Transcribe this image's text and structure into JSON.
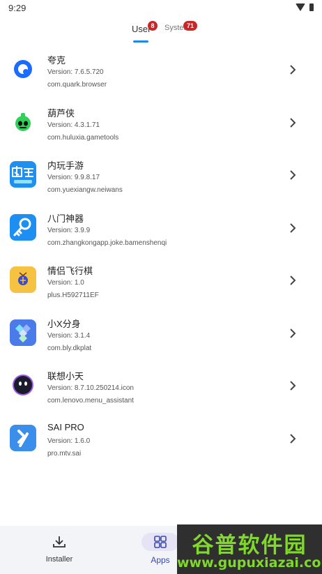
{
  "status": {
    "time": "9:29"
  },
  "tabs": [
    {
      "label": "User",
      "badge": "8"
    },
    {
      "label": "System",
      "badge": "71"
    }
  ],
  "apps": [
    {
      "name": "夸克",
      "version": "Version: 7.6.5.720",
      "package": "com.quark.browser",
      "icon": "quark-icon",
      "color": "#1a6cff"
    },
    {
      "name": "葫芦侠",
      "version": "Version: 4.3.1.71",
      "package": "com.huluxia.gametools",
      "icon": "huluxia-icon",
      "color": "#2fd158"
    },
    {
      "name": "内玩手游",
      "version": "Version: 9.9.8.17",
      "package": "com.yuexiangw.neiwans",
      "icon": "neiwan-icon",
      "color": "#1f8ff0"
    },
    {
      "name": "八门神器",
      "version": "Version: 3.9.9",
      "package": "com.zhangkongapp.joke.bamenshenqi",
      "icon": "bamen-key-icon",
      "color": "#1e8ff2"
    },
    {
      "name": "情侣飞行棋",
      "version": "Version: 1.0",
      "package": "plus.H592711EF",
      "icon": "flight-chess-icon",
      "color": "#f6c241"
    },
    {
      "name": "小X分身",
      "version": "Version: 3.1.4",
      "package": "com.bly.dkplat",
      "icon": "xiaox-icon",
      "color": "#4b7be8"
    },
    {
      "name": "联想小天",
      "version": "Version: 8.7.10.250214.icon",
      "package": "com.lenovo.menu_assistant",
      "icon": "lenovo-assistant-icon",
      "color": "#1c1b2e"
    },
    {
      "name": "SAI PRO",
      "version": "Version: 1.6.0",
      "package": "pro.mtv.sai",
      "icon": "sai-icon",
      "color": "#3b8eea"
    }
  ],
  "nav": {
    "installer_label": "Installer",
    "apps_label": "Apps"
  },
  "watermark": {
    "title": "谷普软件园",
    "url": "www.gupuxiazai.com"
  }
}
